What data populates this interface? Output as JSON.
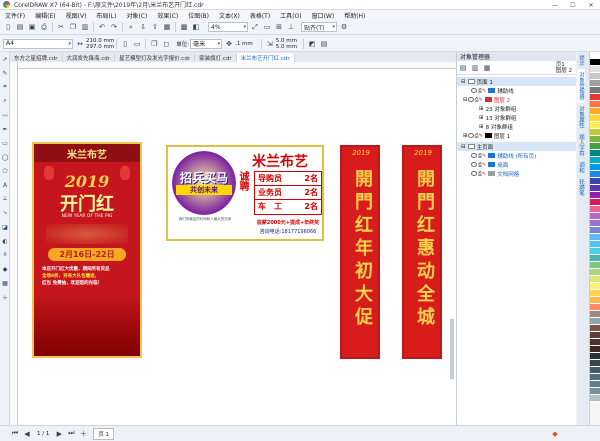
{
  "window": {
    "title": "CorelDRAW X7 (64-Bit) - F:\\原文件\\2019年\\2月\\米兰布艺开门红.cdr"
  },
  "menu": [
    "文件(F)",
    "编辑(E)",
    "视图(V)",
    "布局(L)",
    "对象(C)",
    "效果(C)",
    "位图(B)",
    "文本(X)",
    "表格(T)",
    "工具(O)",
    "窗口(W)",
    "帮助(H)"
  ],
  "toolbar1": {
    "zoom": "4%",
    "snap": "贴齐(T)"
  },
  "toolbar2": {
    "page_size": "A4",
    "width": "210.0 mm",
    "height": "297.0 mm",
    "units_label": "单位:",
    "units": "毫米",
    "nudge": ".1 mm",
    "dup_x": "5.0 mm",
    "dup_y": "5.0 mm"
  },
  "tabs": [
    "东方之星招牌.cdr",
    "大润发先锋海.cdr",
    "星艺模型灯及发光字报价.cdr",
    "家装旗灯.cdr",
    "米兰布艺开门红.cdr"
  ],
  "active_tab": 4,
  "canvas": {
    "poster": {
      "brand": "米兰布艺",
      "year": "2019",
      "headline": "开门红",
      "subtitle": "NEW YEAR OF THE PIG",
      "date": "2月16日-22日",
      "line1": "本店开门红大优惠，期间所有货品",
      "line2": "全场8折，另有大礼包赠送，",
      "line3": "红包 免费抽，欢迎您的光临！"
    },
    "recruit": {
      "brand": "米兰布艺",
      "slogan1": "招兵买马",
      "slogan2": "共创未来",
      "chengpin": "诚聘",
      "positions": [
        {
          "name": "导购员",
          "count": "2名"
        },
        {
          "name": "业务员",
          "count": "2名"
        },
        {
          "name": "车　工",
          "count": "2名"
        }
      ],
      "salary": "底薪2000元+提成+年终奖",
      "phone": "咨询电话:18177196066",
      "note": "我们有最佳的时间和人最大的空间"
    },
    "couplet_left": {
      "text": "開門红年初大促",
      "logo": "2019"
    },
    "couplet_right": {
      "text": "開門红惠动全城",
      "logo": "2019"
    }
  },
  "object_manager": {
    "title": "对象管理器",
    "page_label": "页1",
    "layer_label": "图层 2",
    "rows": [
      {
        "label": "页面 1"
      },
      {
        "label": "辅助线"
      },
      {
        "label": "图层 2"
      },
      {
        "label": "23 对象群组"
      },
      {
        "label": "13 对象群组"
      },
      {
        "label": "8 对象群组"
      },
      {
        "label": "图层 1"
      },
      {
        "label": "主页面"
      },
      {
        "label": "辅助线 (所有页)"
      },
      {
        "label": "桌面"
      },
      {
        "label": "文档网格"
      }
    ]
  },
  "side_tabs": [
    "提示",
    "对象管理器",
    "对象属性",
    "插入字符",
    "调和",
    "轮廓笔"
  ],
  "status": {
    "page": "1 / 1",
    "page_tab": "页 1"
  },
  "palette": [
    "#ffffff",
    "#000000",
    "#e0e0e0",
    "#c8c8c8",
    "#a0a0a0",
    "#787878",
    "#e53935",
    "#ff7043",
    "#ffa726",
    "#fdd835",
    "#ffee58",
    "#c0ca33",
    "#7cb342",
    "#43a047",
    "#00897b",
    "#00acc1",
    "#039be5",
    "#1e88e5",
    "#3949ab",
    "#5e35b1",
    "#8e24aa",
    "#d81b60",
    "#f06292",
    "#ba68c8",
    "#9575cd",
    "#7986cb",
    "#64b5f6",
    "#4fc3f7",
    "#4dd0e1",
    "#4db6ac",
    "#81c784",
    "#aed581",
    "#dce775",
    "#fff176",
    "#ffd54f",
    "#ffb74d",
    "#ff8a65",
    "#a1887f",
    "#90a4ae",
    "#795548",
    "#5d4037",
    "#4e342e",
    "#3e2723",
    "#263238",
    "#37474f",
    "#455a64",
    "#546e7a",
    "#607d8b",
    "#78909c",
    "#b0bec5"
  ]
}
